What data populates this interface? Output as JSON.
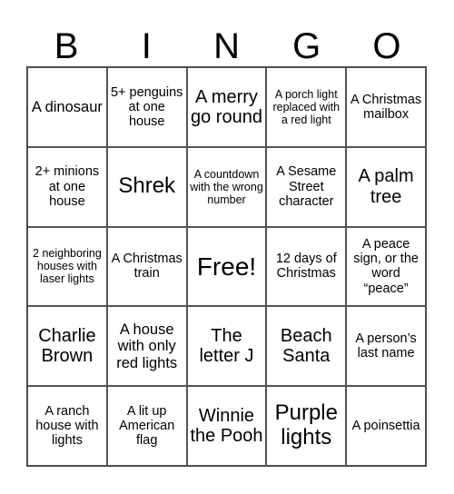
{
  "header": {
    "letters": [
      "B",
      "I",
      "N",
      "G",
      "O"
    ]
  },
  "cells": [
    {
      "text": "A dinosaur",
      "size": "s-md"
    },
    {
      "text": "5+ penguins at one house",
      "size": "s-sm"
    },
    {
      "text": "A merry go round",
      "size": "s-lg"
    },
    {
      "text": "A porch light replaced with a red light",
      "size": "s-xs"
    },
    {
      "text": "A Christmas mailbox",
      "size": "s-sm"
    },
    {
      "text": "2+ minions at one house",
      "size": "s-sm"
    },
    {
      "text": "Shrek",
      "size": "s-xl"
    },
    {
      "text": "A countdown with the wrong number",
      "size": "s-xs"
    },
    {
      "text": "A Sesame Street character",
      "size": "s-sm"
    },
    {
      "text": "A palm tree",
      "size": "s-lg"
    },
    {
      "text": "2 neighboring houses with laser lights",
      "size": "s-xs"
    },
    {
      "text": "A Christmas train",
      "size": "s-sm"
    },
    {
      "text": "Free!",
      "size": "s-xxl"
    },
    {
      "text": "12 days of Christmas",
      "size": "s-sm"
    },
    {
      "text": "A peace sign, or the word “peace”",
      "size": "s-sm"
    },
    {
      "text": "Charlie Brown",
      "size": "s-lg"
    },
    {
      "text": "A house with only red lights",
      "size": "s-md"
    },
    {
      "text": "The letter J",
      "size": "s-lg"
    },
    {
      "text": "Beach Santa",
      "size": "s-lg"
    },
    {
      "text": "A person’s last name",
      "size": "s-sm"
    },
    {
      "text": "A ranch house with lights",
      "size": "s-sm"
    },
    {
      "text": "A lit up American flag",
      "size": "s-sm"
    },
    {
      "text": "Winnie the Pooh",
      "size": "s-lg"
    },
    {
      "text": "Purple lights",
      "size": "s-xl"
    },
    {
      "text": "A poinsettia",
      "size": "s-sm"
    }
  ]
}
